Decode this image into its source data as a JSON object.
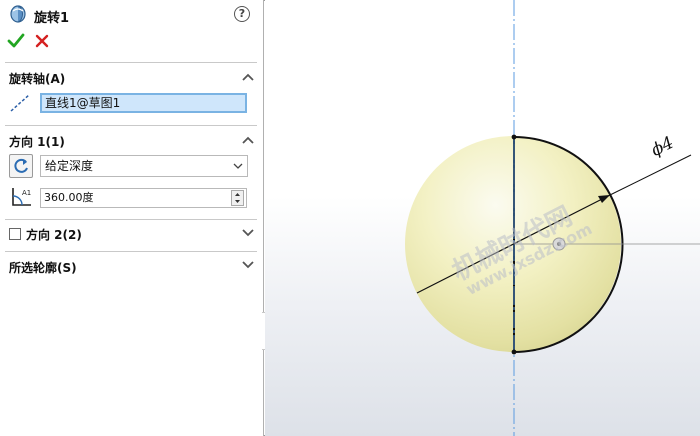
{
  "feature": {
    "title": "旋转1"
  },
  "sections": {
    "axis": {
      "title": "旋转轴(A)",
      "value": "直线1@草图1"
    },
    "direction1": {
      "title": "方向 1(1)",
      "end_condition": "给定深度",
      "angle": "360.00度"
    },
    "direction2": {
      "title": "方向 2(2)"
    },
    "selected_contours": {
      "title": "所选轮廓(S)"
    }
  },
  "viewport": {
    "dimension_label": "ϕ4",
    "watermark": "机械时代网",
    "watermark_url": "www.jxsdz.com"
  },
  "colors": {
    "accent": "#7ab3e3",
    "ok": "#22a622",
    "cancel": "#d42020",
    "axis_line": "#4a90d9",
    "sphere": "#f3f1c4"
  }
}
